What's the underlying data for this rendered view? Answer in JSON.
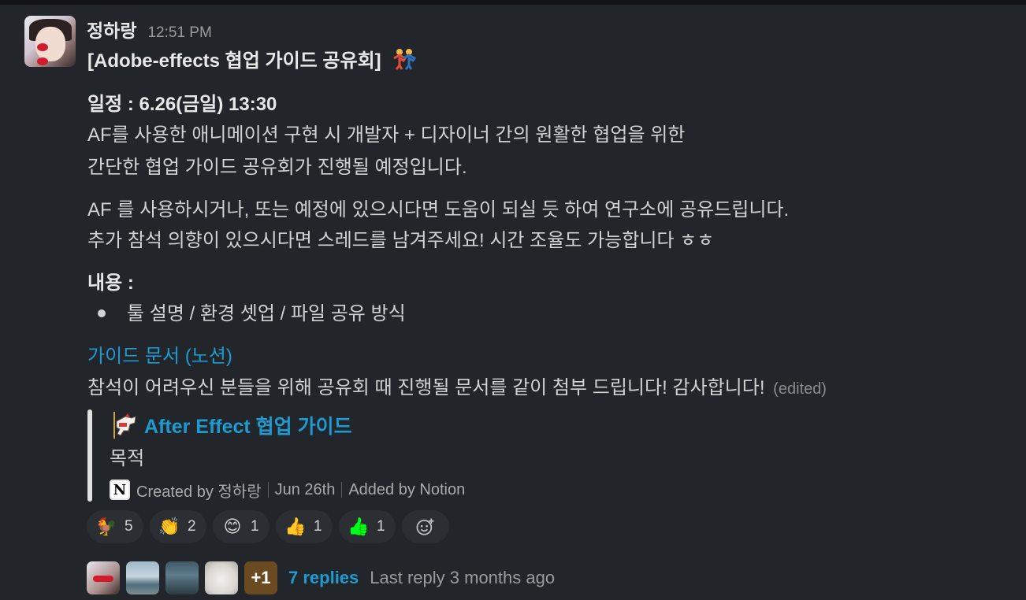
{
  "message": {
    "author": "정하랑",
    "time": "12:51 PM",
    "title": "[Adobe-effects 협업 가이드 공유회]",
    "schedule": "일정 : 6.26(금일) 13:30",
    "intro_line1": "AF를 사용한 애니메이션 구현 시 개발자 + 디자이너 간의 원활한 협업을 위한",
    "intro_line2": "간단한 협업 가이드 공유회가 진행될 예정입니다.",
    "para2_line1": "AF 를 사용하시거나, 또는 예정에 있으시다면 도움이 되실 듯 하여 연구소에 공유드립니다.",
    "para2_line2": "추가 참석 의향이 있으시다면 스레드를 남겨주세요! 시간 조율도 가능합니다 ㅎㅎ",
    "contents_label": "내용 :",
    "bullet_item": "툴 설명 / 환경 셋업 / 파일 공유 방식",
    "guide_link": "가이드 문서 (노션)",
    "closing": "참석이 어려우신 분들을 위해 공유회 때 진행될 문서를 같이 첨부 드립니다! 감사합니다!",
    "edited": "(edited)"
  },
  "attachment": {
    "icon": "carousel-horse-icon",
    "title": "After Effect 협업 가이드",
    "description": "목적",
    "created_by": "Created by 정하랑",
    "date": "Jun 26th",
    "added_by": "Added by Notion",
    "source_icon": "notion-icon",
    "source_letter": "N"
  },
  "reactions": [
    {
      "icon": "rooster-icon",
      "glyph": "🐓",
      "count": "5"
    },
    {
      "icon": "clapping-hands-icon",
      "glyph": "👏",
      "count": "2"
    },
    {
      "icon": "smiling-face-icon",
      "glyph": "😊",
      "count": "1"
    },
    {
      "icon": "thumbs-up-light-icon",
      "glyph": "👍",
      "count": "1"
    },
    {
      "icon": "thumbs-up-green-icon",
      "glyph": "👍",
      "count": "1"
    }
  ],
  "add_reaction_icon": "add-reaction-icon",
  "thread": {
    "extra_count": "+1",
    "replies": "7 replies",
    "last_reply": "Last reply 3 months ago"
  }
}
